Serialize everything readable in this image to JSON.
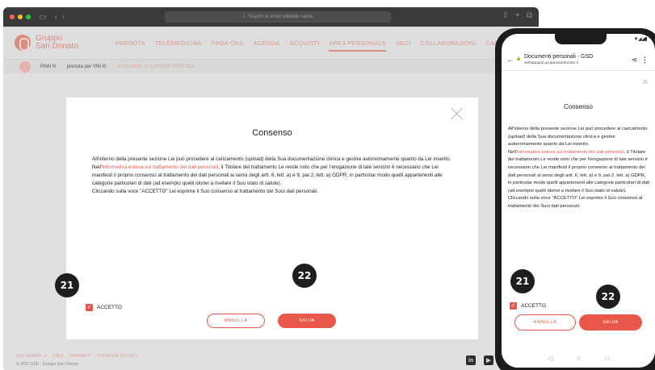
{
  "browser": {
    "url_placeholder": "Search or enter website name",
    "traffic_colors": {
      "close": "#ff5f57",
      "minimize": "#febc2e",
      "zoom": "#28c840"
    }
  },
  "site": {
    "brand_line1": "Gruppo",
    "brand_line2": "San Donato",
    "brand_color": "#d98c80",
    "nav": [
      {
        "label": "PRENOTA",
        "active": false
      },
      {
        "label": "TELEMEDICINA",
        "active": false
      },
      {
        "label": "PAGA ORA",
        "active": false
      },
      {
        "label": "AGENDA",
        "active": false
      },
      {
        "label": "ACQUISTI",
        "active": false
      },
      {
        "label": "AREA PERSONALE",
        "active": true
      },
      {
        "label": "SEDI",
        "active": false
      },
      {
        "label": "COLLABORAZIONI",
        "active": false
      },
      {
        "label": "CARRI",
        "active": false
      }
    ],
    "subbar": {
      "user_name": "RNN N.",
      "booking_text": "prenota per VNI R.",
      "action_text": "AGGIUNGI O CAMBIA PROFILO"
    },
    "footer": {
      "links": [
        "CHI SIAMO ↗",
        "FAQ",
        "PRIVACY",
        "COOKIES POLICY"
      ],
      "copyright": "© 2022 GSD - Gruppo San Donato"
    },
    "social": [
      "in",
      "▶"
    ]
  },
  "modal": {
    "title": "Consenso",
    "para1_a": "All'interno della presente sezione Lei può procedere al caricamento ",
    "para1_em": "(upload)",
    "para1_b": " della Sua documentazione clinica e gestire autonomamente quanto da Lei inserito.",
    "para2_pre": "Nell'",
    "para2_link": "Informativa estesa sul trattamento dei dati personali",
    "para2_post": ", il Titolare del trattamento Le rende noto che per l'erogazione di tale servizio è necessario che Lei manifesti il proprio consenso al trattamento dei dati personali ai sensi degli artt. 6, lett. a) e 9, par.2, lett. a) GDPR, in particolar modo quelli appartenenti alle categorie particolari di dati (ad esempio quelli idonei a rivelare il Suo stato di salute).",
    "para3": "Cliccando sulla voce \"ACCETTO\" Lei esprime il Suo consenso al trattamento dei Suoi dati personali.",
    "checkbox_label": "ACCETTO",
    "checkbox_checked": true,
    "cancel_label": "ANNULLA",
    "save_label": "SALVA",
    "accent_color": "#e05a4f"
  },
  "phone": {
    "page_title": "Documenti personali - GSD",
    "url": "webappgsd.grupposandonato.it"
  },
  "badges": {
    "checkbox": "21",
    "save": "22"
  }
}
